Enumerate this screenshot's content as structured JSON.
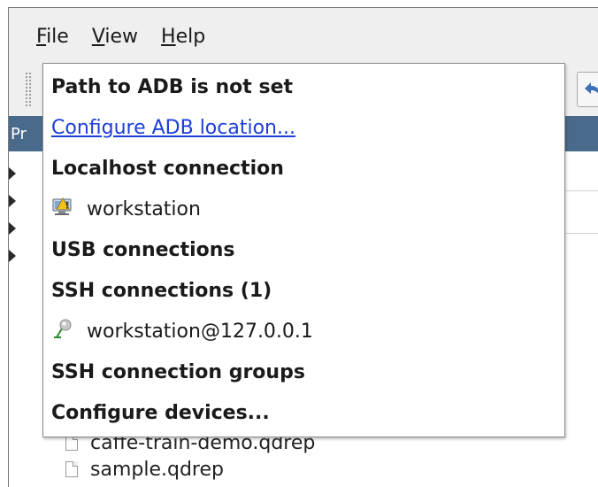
{
  "menubar": {
    "items": [
      {
        "mnemonic": "F",
        "rest": "ile"
      },
      {
        "mnemonic": "V",
        "rest": "iew"
      },
      {
        "mnemonic": "H",
        "rest": "elp"
      }
    ]
  },
  "panel_header": {
    "label": "Pr"
  },
  "tree": {
    "files": [
      {
        "name": "caffe-train-demo.qdrep"
      },
      {
        "name": "sample.qdrep"
      }
    ]
  },
  "popup": {
    "adb_status": "Path to ADB is not set",
    "configure_adb": "Configure ADB location...",
    "localhost_header": "Localhost connection",
    "localhost_item": "workstation",
    "usb_header": "USB connections",
    "ssh_header": "SSH connections (1)",
    "ssh_item": "workstation@127.0.0.1",
    "ssh_groups_header": "SSH connection groups",
    "configure_devices": "Configure devices..."
  },
  "colors": {
    "link": "#1a3fd8",
    "header_bar": "#4a6a8c"
  },
  "icons": {
    "localhost": "computer-warning-icon",
    "ssh": "network-pin-icon",
    "toolbar": "back-arrow-icon"
  }
}
